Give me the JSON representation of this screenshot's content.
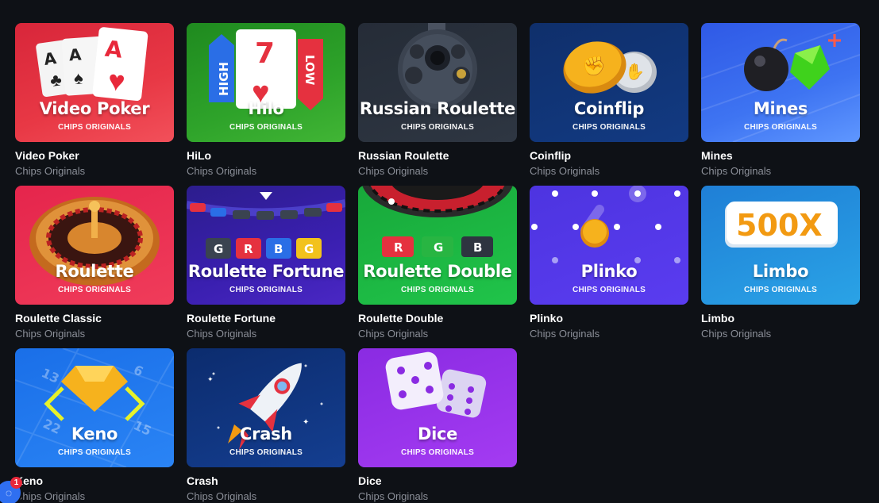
{
  "games": [
    {
      "key": "video-poker",
      "thumb_title": "Video Poker",
      "thumb_sub": "CHIPS ORIGINALS",
      "title": "Video Poker",
      "provider": "Chips Originals"
    },
    {
      "key": "hilo",
      "thumb_title": "Hilo",
      "thumb_sub": "CHIPS ORIGINALS",
      "title": "HiLo",
      "provider": "Chips Originals",
      "art_text": {
        "high": "HIGH",
        "low": "LOW",
        "card": "7"
      }
    },
    {
      "key": "russian-roulette",
      "thumb_title": "Russian Roulette",
      "thumb_sub": "CHIPS ORIGINALS",
      "title": "Russian Roulette",
      "provider": "Chips Originals"
    },
    {
      "key": "coinflip",
      "thumb_title": "Coinflip",
      "thumb_sub": "CHIPS ORIGINALS",
      "title": "Coinflip",
      "provider": "Chips Originals"
    },
    {
      "key": "mines",
      "thumb_title": "Mines",
      "thumb_sub": "CHIPS ORIGINALS",
      "title": "Mines",
      "provider": "Chips Originals"
    },
    {
      "key": "roulette-classic",
      "thumb_title": "Roulette",
      "thumb_sub": "CHIPS ORIGINALS",
      "title": "Roulette Classic",
      "provider": "Chips Originals"
    },
    {
      "key": "roulette-fortune",
      "thumb_title": "Roulette Fortune",
      "thumb_sub": "CHIPS ORIGINALS",
      "title": "Roulette Fortune",
      "provider": "Chips Originals",
      "art_text": {
        "tiles": [
          "G",
          "R",
          "B",
          "G"
        ]
      }
    },
    {
      "key": "roulette-double",
      "thumb_title": "Roulette Double",
      "thumb_sub": "CHIPS ORIGINALS",
      "title": "Roulette Double",
      "provider": "Chips Originals",
      "art_text": {
        "tiles": [
          "R",
          "G",
          "B"
        ]
      }
    },
    {
      "key": "plinko",
      "thumb_title": "Plinko",
      "thumb_sub": "CHIPS ORIGINALS",
      "title": "Plinko",
      "provider": "Chips Originals"
    },
    {
      "key": "limbo",
      "thumb_title": "Limbo",
      "thumb_sub": "CHIPS ORIGINALS",
      "title": "Limbo",
      "provider": "Chips Originals",
      "art_text": {
        "multiplier": "500X"
      }
    },
    {
      "key": "keno",
      "thumb_title": "Keno",
      "thumb_sub": "CHIPS ORIGINALS",
      "title": "Keno",
      "provider": "Chips Originals",
      "art_text": {
        "n1": "13",
        "n2": "6",
        "n3": "22",
        "n4": "15"
      }
    },
    {
      "key": "crash",
      "thumb_title": "Crash",
      "thumb_sub": "CHIPS ORIGINALS",
      "title": "Crash",
      "provider": "Chips Originals"
    },
    {
      "key": "dice",
      "thumb_title": "Dice",
      "thumb_sub": "CHIPS ORIGINALS",
      "title": "Dice",
      "provider": "Chips Originals"
    }
  ],
  "chat": {
    "badge": "1"
  },
  "colors": {
    "page_bg": "#0e1116",
    "subtitle": "#8b8f98",
    "accent": "#2f6ff0"
  }
}
